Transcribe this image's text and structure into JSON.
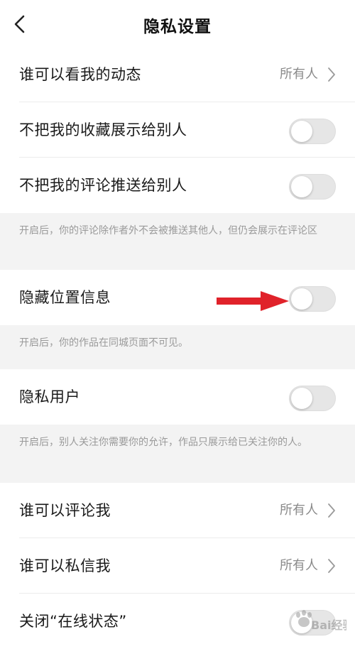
{
  "header": {
    "title": "隐私设置"
  },
  "rows": {
    "who_can_see_activity": {
      "label": "谁可以看我的动态",
      "value": "所有人"
    },
    "hide_favorites": {
      "label": "不把我的收藏展示给别人",
      "on": false
    },
    "no_push_comments": {
      "label": "不把我的评论推送给别人",
      "on": false
    },
    "hide_location": {
      "label": "隐藏位置信息",
      "on": false
    },
    "private_user": {
      "label": "隐私用户",
      "on": false
    },
    "who_can_comment": {
      "label": "谁可以评论我",
      "value": "所有人"
    },
    "who_can_message": {
      "label": "谁可以私信我",
      "value": "所有人"
    },
    "close_online_status": {
      "label": "关闭“在线状态”",
      "on": false
    }
  },
  "notes": {
    "comments_note": "开启后，你的评论除作者外不会被推送其他人，但仍会展示在评论区",
    "location_note": "开启后，你的作品在同城页面不可见。",
    "private_note": "开启后，别人关注你需要你的允许，作品只展示给已关注你的人。"
  },
  "colors": {
    "toggle_off": "#e6e6e6",
    "annotation_arrow": "#e0222a",
    "value_text": "#8a8a8a",
    "note_text": "#9a9a9a"
  },
  "icons": {
    "back": "chevron-left-icon",
    "chevron": "chevron-right-icon",
    "annotation": "red-arrow-icon",
    "watermark": "baidu-jingyan-watermark"
  },
  "watermark": {
    "text": "Bai经验"
  }
}
